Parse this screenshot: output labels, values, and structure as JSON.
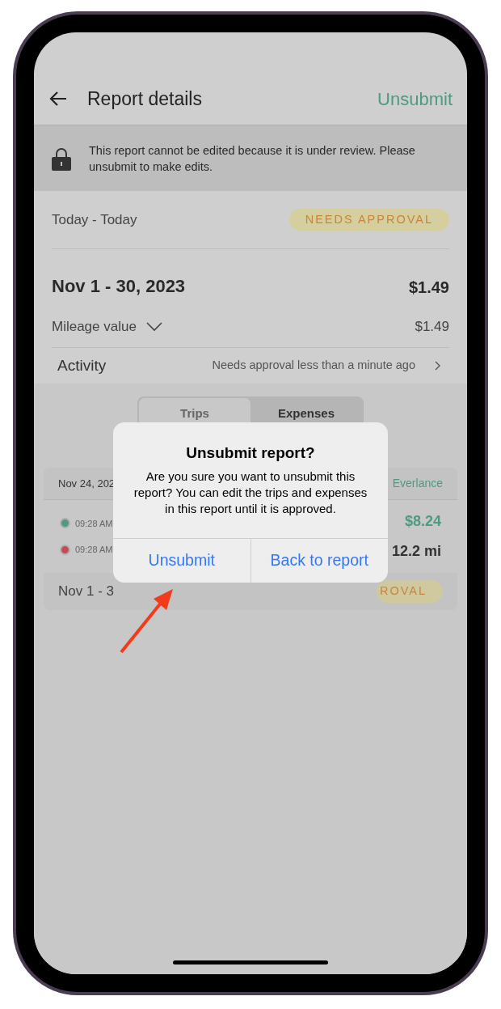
{
  "header": {
    "title": "Report details",
    "action": "Unsubmit"
  },
  "banner": {
    "text": "This report cannot be edited because it is under review. Please unsubmit to make edits."
  },
  "summary": {
    "period": "Today - Today",
    "status": "NEEDS APPROVAL",
    "range": "Nov 1 - 30, 2023",
    "total": "$1.49",
    "breakdown_label": "Mileage value",
    "breakdown_value": "$1.49",
    "expanded": false
  },
  "activity": {
    "label": "Activity",
    "detail": "Needs approval less than a minute ago"
  },
  "tabs": [
    {
      "label": "Trips",
      "selected": true
    },
    {
      "label": "Expenses",
      "selected": false
    }
  ],
  "trip_card": {
    "date": "Nov 24, 202",
    "source": "Everlance",
    "stops": [
      {
        "time": "09:28 AM",
        "color": "#4f9a80"
      },
      {
        "time": "09:28 AM",
        "color": "#c94a55"
      }
    ],
    "amount": "$8.24",
    "distance": "12.2 mi",
    "footer_range": "Nov 1 - 3",
    "footer_status": "ROVAL"
  },
  "dialog": {
    "title": "Unsubmit report?",
    "message": "Are you sure you want to unsubmit this report? You can edit the trips and expenses in this report until it is approved.",
    "buttons": [
      "Unsubmit",
      "Back to report"
    ]
  }
}
